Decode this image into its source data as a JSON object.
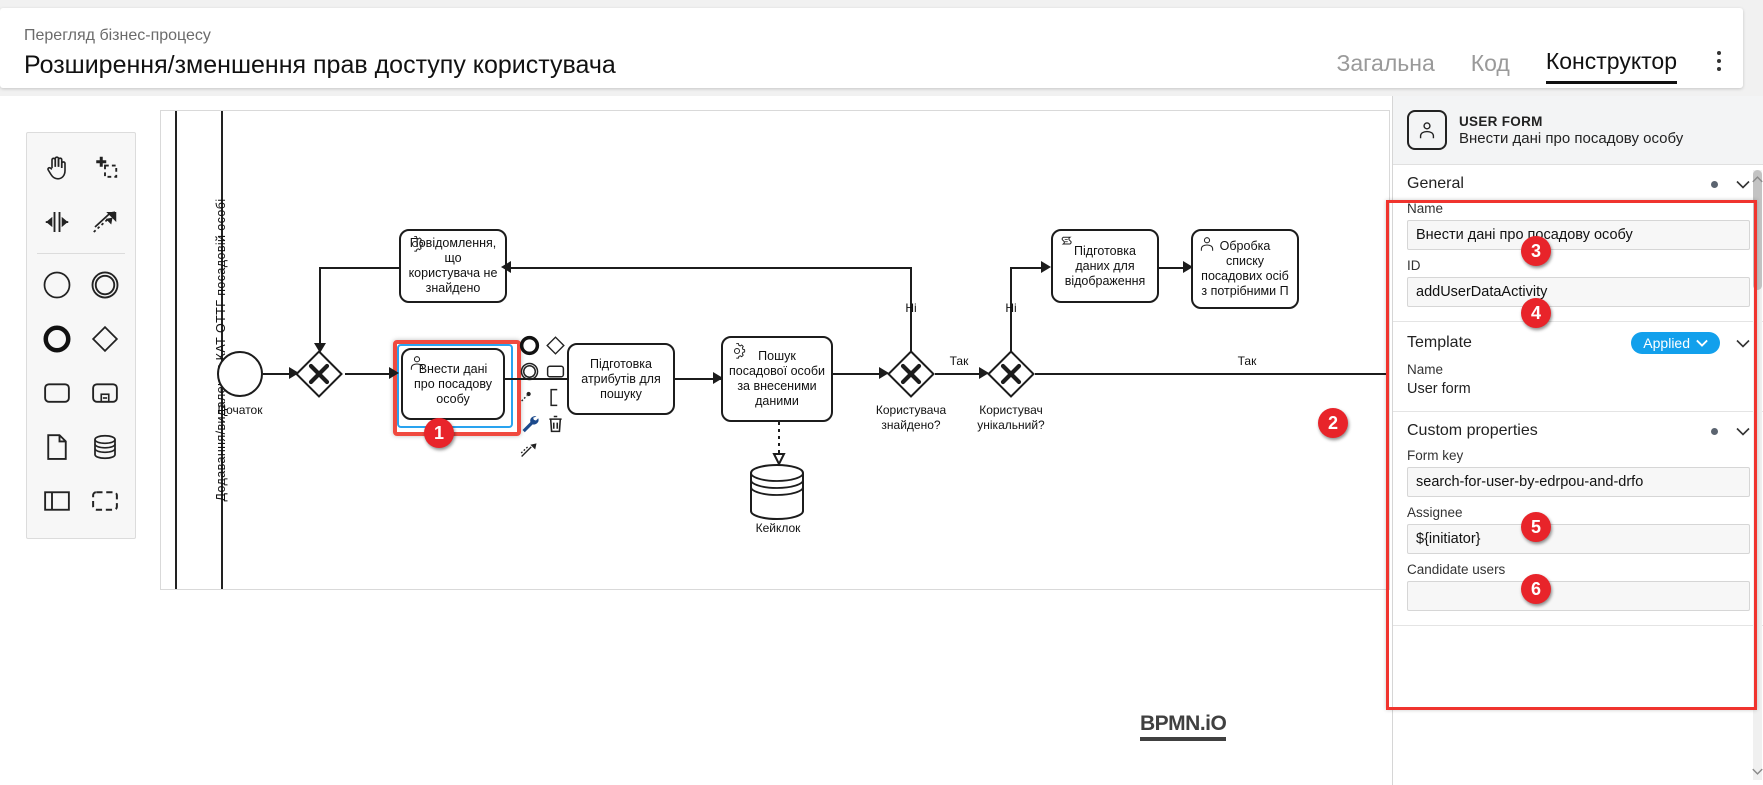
{
  "header": {
    "subtitle": "Перегляд бізнес-процесу",
    "title": "Розширення/зменшення прав доступу користувача",
    "tabs": [
      {
        "label": "Загальна",
        "active": false
      },
      {
        "label": "Код",
        "active": false
      },
      {
        "label": "Конструктор",
        "active": true
      }
    ],
    "overflow_icon": "kebab-menu-icon"
  },
  "palette": {
    "tools": [
      {
        "name": "hand-tool-icon",
        "label": "Activate the hand tool"
      },
      {
        "name": "lasso-tool-icon",
        "label": "Activate the lasso tool"
      },
      {
        "name": "space-tool-icon",
        "label": "Activate the create/remove space tool"
      },
      {
        "name": "connect-tool-icon",
        "label": "Activate the global connect tool"
      }
    ],
    "elements": [
      {
        "name": "start-event-icon",
        "label": "Create StartEvent"
      },
      {
        "name": "intermediate-event-icon",
        "label": "Create Intermediate/Boundary Event"
      },
      {
        "name": "end-event-icon",
        "label": "Create EndEvent"
      },
      {
        "name": "exclusive-gateway-icon",
        "label": "Create Gateway"
      },
      {
        "name": "task-icon",
        "label": "Create Task"
      },
      {
        "name": "subprocess-icon",
        "label": "Create expanded SubProcess"
      },
      {
        "name": "data-object-icon",
        "label": "Create DataObjectReference"
      },
      {
        "name": "data-store-icon",
        "label": "Create DataStoreReference"
      },
      {
        "name": "participant-icon",
        "label": "Create Pool/Participant"
      },
      {
        "name": "group-icon",
        "label": "Create Group"
      }
    ]
  },
  "diagram": {
    "lane_label": "Додавання/видалення КАТ ОТТГ посадовій особі",
    "watermark": "BPMN.iO",
    "nodes": [
      {
        "id": "start",
        "type": "start-event",
        "label": "Початок"
      },
      {
        "id": "gw1",
        "type": "exclusive-gateway",
        "label": ""
      },
      {
        "id": "msg_not_found",
        "type": "service-task",
        "label": "Повідомлення, що користувача не знайдено"
      },
      {
        "id": "enter_data",
        "type": "user-task",
        "label": "Внести дані про посадову особу",
        "selected": true
      },
      {
        "id": "prep_attrs",
        "type": "task",
        "label": "Підготовка атрибутів для пошуку"
      },
      {
        "id": "search_person",
        "type": "service-task",
        "label": "Пошук посадової особи за внесеними даними"
      },
      {
        "id": "keycloak",
        "type": "data-store",
        "label": "Кейклок"
      },
      {
        "id": "gw_found",
        "type": "exclusive-gateway",
        "label": "Користувача знайдено?"
      },
      {
        "id": "gw_unique",
        "type": "exclusive-gateway",
        "label": "Користувач унікальний?"
      },
      {
        "id": "prep_display",
        "type": "script-task",
        "label": "Підготовка даних для відображення"
      },
      {
        "id": "process_list",
        "type": "user-task",
        "label": "Обробка списку посадових осіб з потрібними П"
      }
    ],
    "flow_labels": [
      {
        "id": "f1",
        "text": "Ні"
      },
      {
        "id": "f2",
        "text": "Ні"
      },
      {
        "id": "f3",
        "text": "Так"
      },
      {
        "id": "f4",
        "text": "Так"
      }
    ]
  },
  "context_pad": {
    "items": [
      {
        "name": "append-end-event-icon"
      },
      {
        "name": "append-gateway-icon"
      },
      {
        "name": "append-task-icon"
      },
      {
        "name": "append-intermediate-event-icon"
      },
      {
        "name": "append-text-annotation-icon"
      },
      {
        "name": "connect-icon"
      },
      {
        "name": "delete-icon"
      },
      {
        "name": "wrench-icon"
      },
      {
        "name": "append-sequence-flow-icon"
      }
    ]
  },
  "properties": {
    "header": {
      "icon": "user-task-icon",
      "type": "USER FORM",
      "name": "Внести дані про посадову особу"
    },
    "groups": [
      {
        "id": "general",
        "title": "General",
        "has_dot": true,
        "fields": [
          {
            "label": "Name",
            "value": "Внести дані про посадову особу",
            "marker": "3"
          },
          {
            "label": "ID",
            "value": "addUserDataActivity",
            "marker": "4"
          }
        ]
      },
      {
        "id": "template",
        "title": "Template",
        "pill": "Applied",
        "fields": [
          {
            "label": "Name",
            "value": "User form",
            "marker": "2"
          }
        ]
      },
      {
        "id": "custom",
        "title": "Custom properties",
        "has_dot": true,
        "fields": [
          {
            "label": "Form key",
            "value": "search-for-user-by-edrpou-and-drfo",
            "marker": "5"
          },
          {
            "label": "Assignee",
            "value": "${initiator}",
            "marker": "6"
          },
          {
            "label": "Candidate users",
            "value": ""
          }
        ]
      }
    ]
  },
  "markers": [
    {
      "id": "m1",
      "text": "1"
    },
    {
      "id": "m2",
      "text": "2"
    },
    {
      "id": "m3",
      "text": "3"
    },
    {
      "id": "m4",
      "text": "4"
    },
    {
      "id": "m5",
      "text": "5"
    },
    {
      "id": "m6",
      "text": "6"
    }
  ],
  "colors": {
    "marker_red": "#e8242a",
    "highlight_red": "#f0342e",
    "selection_blue": "#29a3ef",
    "pill_blue": "#12a0ec",
    "header_grey": "#f3f4f5"
  }
}
